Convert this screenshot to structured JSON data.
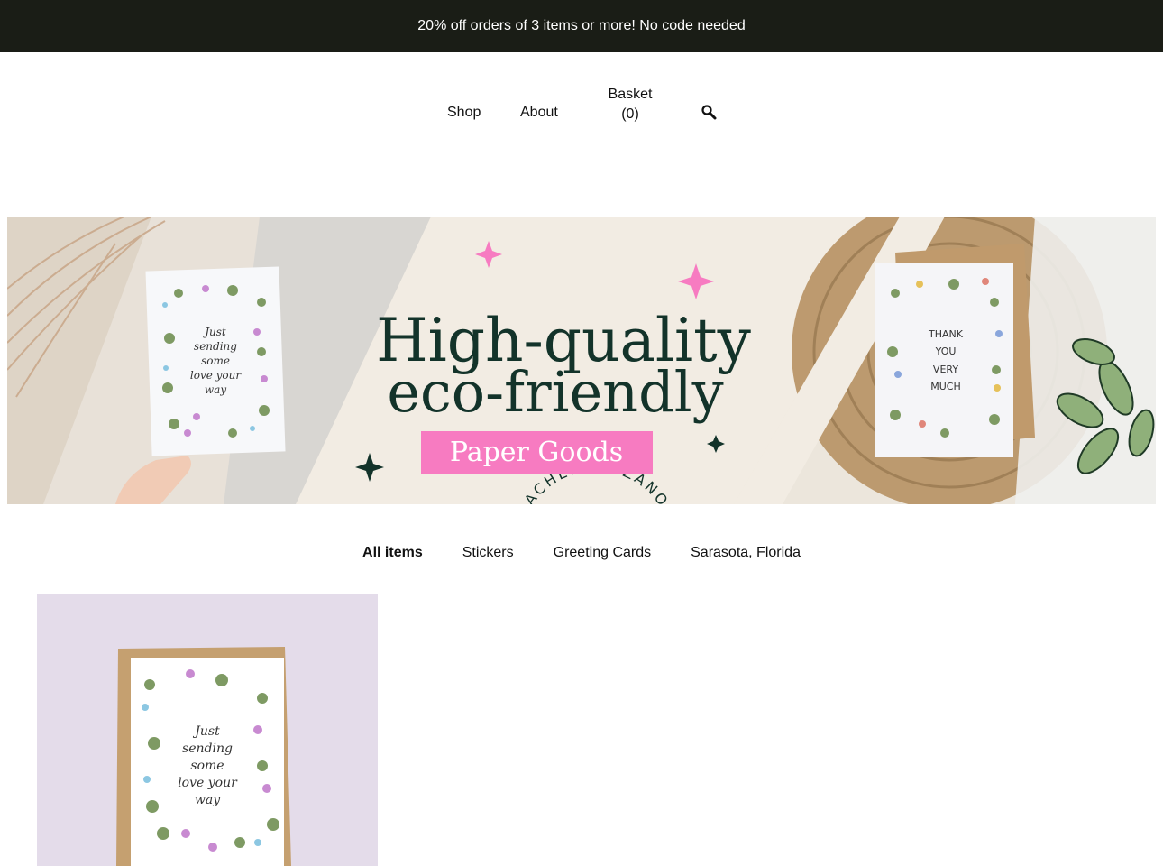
{
  "announcement": "20% off orders of 3 items or more! No code needed",
  "nav": {
    "shop": "Shop",
    "about": "About",
    "basket_label": "Basket",
    "basket_count": "(0)",
    "search_icon": "search-icon"
  },
  "banner": {
    "arc_text": "RACHELMANZANO.COM",
    "headline_1": "High-quality",
    "headline_2": "eco-friendly",
    "pill": "Paper Goods",
    "card_left": [
      "Just",
      "sending",
      "some",
      "love your",
      "way"
    ],
    "card_right": [
      "THANK",
      "YOU",
      "VERY",
      "MUCH"
    ],
    "colors": {
      "ink": "#13332a",
      "pink": "#f77bc1",
      "cream": "#f2ece3"
    }
  },
  "categories": [
    {
      "label": "All items",
      "active": true
    },
    {
      "label": "Stickers",
      "active": false
    },
    {
      "label": "Greeting Cards",
      "active": false
    },
    {
      "label": "Sarasota, Florida",
      "active": false
    }
  ],
  "product": {
    "card_text": [
      "Just",
      "sending",
      "some",
      "love your",
      "way"
    ]
  }
}
